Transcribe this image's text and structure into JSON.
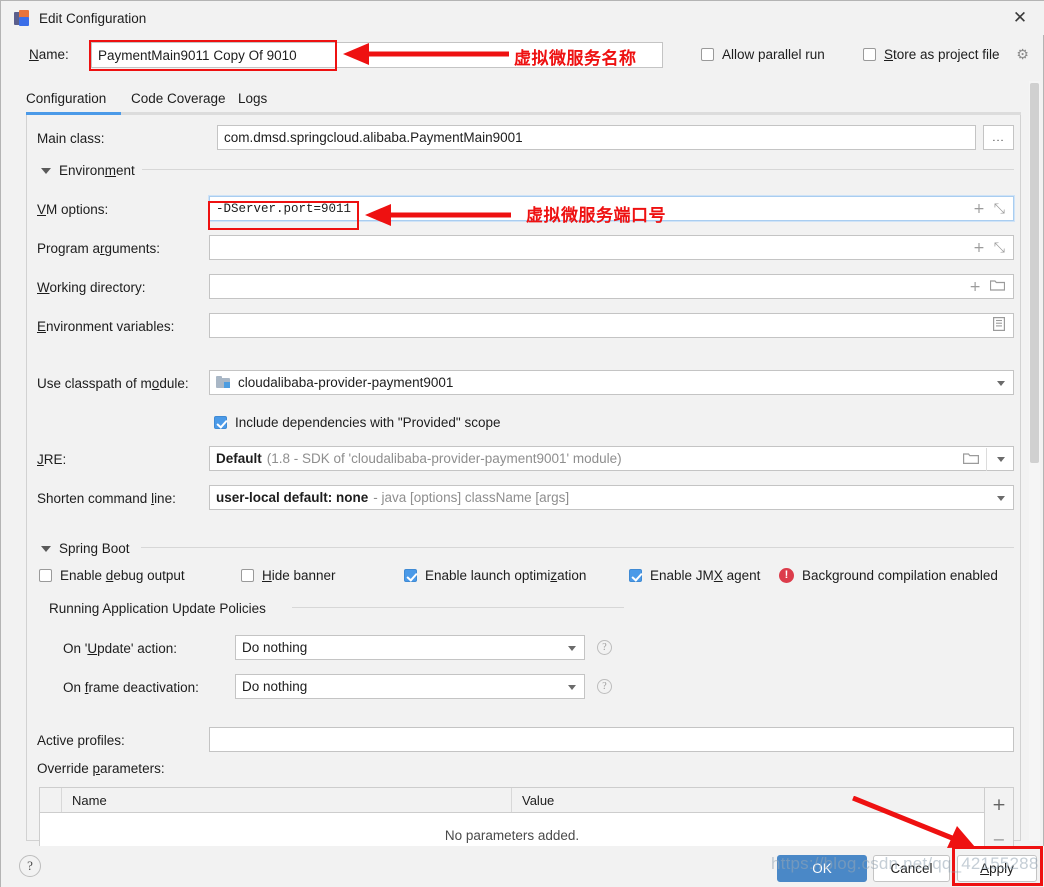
{
  "window": {
    "title": "Edit Configuration",
    "close_label": "✕",
    "app_icon": "intellij-idea-icon"
  },
  "name_row": {
    "label": "Name:",
    "label_underline": "N",
    "value": "PaymentMain9011 Copy Of 9010",
    "allow_parallel_run": {
      "label": "Allow parallel run",
      "checked": false
    },
    "store_as_project_file": {
      "label": "Store as project file",
      "checked": false
    },
    "gear_icon": "⚙"
  },
  "tabs": [
    {
      "label": "Configuration",
      "active": true
    },
    {
      "label": "Code Coverage",
      "active": false
    },
    {
      "label": "Logs",
      "active": false
    }
  ],
  "form": {
    "main_class": {
      "label": "Main class:",
      "value": "com.dmsd.springcloud.alibaba.PaymentMain9001",
      "browse_label": "..."
    },
    "environment_group": "Environment",
    "vm_options": {
      "label": "VM options:",
      "value": "-DServer.port=9011",
      "expand_icon": "⤡",
      "add_icon": "+"
    },
    "program_arguments": {
      "label": "Program arguments:",
      "value": "",
      "expand_icon": "⤡",
      "add_icon": "+"
    },
    "working_directory": {
      "label": "Working directory:",
      "value": "",
      "folder_icon": "📁",
      "add_icon": "+"
    },
    "environment_variables": {
      "label": "Environment variables:",
      "value": "",
      "list_icon": "▤"
    },
    "use_classpath_of_module": {
      "label": "Use classpath of module:",
      "value": "cloudalibaba-provider-payment9001",
      "module_icon": "module-icon"
    },
    "include_provided": {
      "label": "Include dependencies with \"Provided\" scope",
      "checked": true
    },
    "jre": {
      "label": "JRE:",
      "value": "Default",
      "detail": "(1.8 - SDK of 'cloudalibaba-provider-payment9001' module)",
      "folder_icon": "📁"
    },
    "shorten_command_line": {
      "label": "Shorten command line:",
      "value": "user-local default: none",
      "detail": "- java [options] className [args]"
    },
    "spring_boot_group": "Spring Boot",
    "spring_boot_checks": [
      {
        "label": "Enable debug output",
        "checked": false
      },
      {
        "label": "Hide banner",
        "checked": false
      },
      {
        "label": "Enable launch optimization",
        "checked": true
      },
      {
        "label": "Enable JMX agent",
        "checked": true
      }
    ],
    "background_compilation": {
      "label": "Background compilation enabled",
      "icon": "error-icon",
      "icon_glyph": "!"
    },
    "update_policies_group": "Running Application Update Policies",
    "on_update_action": {
      "label": "On 'Update' action:",
      "value": "Do nothing",
      "help_icon": "?"
    },
    "on_frame_deactivation": {
      "label": "On frame deactivation:",
      "value": "Do nothing",
      "help_icon": "?"
    },
    "active_profiles": {
      "label": "Active profiles:",
      "value": ""
    },
    "override_parameters": {
      "label": "Override parameters:",
      "columns": [
        "Name",
        "Value"
      ],
      "empty_text": "No parameters added.",
      "add_icon": "+",
      "remove_icon": "−"
    }
  },
  "bottom": {
    "help_label": "?",
    "ok_label": "OK",
    "cancel_label": "Cancel",
    "apply_label": "Apply",
    "apply_underline": "A"
  },
  "annotations": [
    {
      "text": "虚拟微服务名称",
      "name": "annotation-service-name"
    },
    {
      "text": "虚拟微服务端口号",
      "name": "annotation-service-port"
    }
  ],
  "watermark": {
    "text": "https://blog.csdn.net/qq_42155288"
  },
  "colors": {
    "accent": "#4b9ae8",
    "annotation_red": "#ee1111",
    "primary_button": "#4a88c7",
    "error_red": "#dc3c4b",
    "panel_bg": "#f2f2f2"
  }
}
